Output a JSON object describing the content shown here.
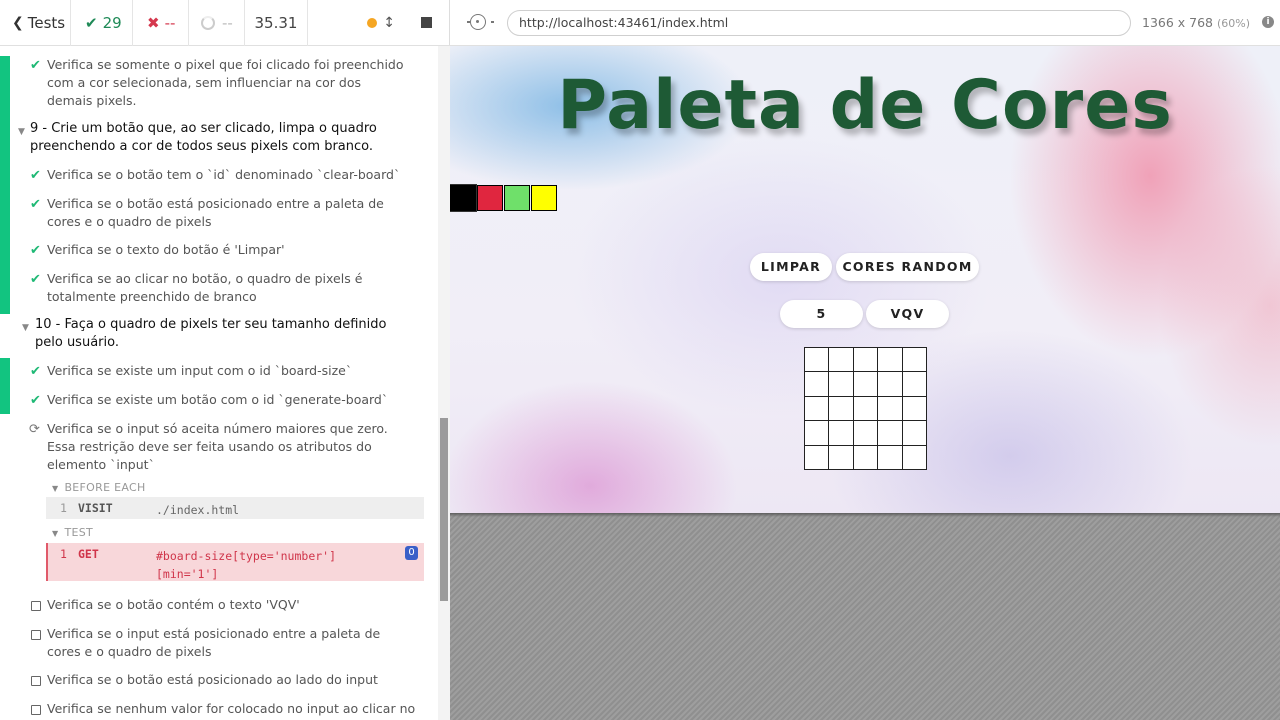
{
  "topbar": {
    "tests_label": "Tests",
    "passed": "29",
    "failed": "--",
    "pending": "--",
    "duration": "35.31"
  },
  "tests": {
    "t_pixel_fill": "Verifica se somente o pixel que foi clicado foi preenchido com a cor selecionada, sem influenciar na cor dos demais pixels.",
    "req9": "9 - Crie um botão que, ao ser clicado, limpa o quadro preenchendo a cor de todos seus pixels com branco.",
    "t9_1": "Verifica se o botão tem o `id` denominado `clear-board`",
    "t9_2": "Verifica se o botão está posicionado entre a paleta de cores e o quadro de pixels",
    "t9_3": "Verifica se o texto do botão é 'Limpar'",
    "t9_4": "Verifica se ao clicar no botão, o quadro de pixels é totalmente preenchido de branco",
    "req10": "10 - Faça o quadro de pixels ter seu tamanho definido pelo usuário.",
    "t10_1": "Verifica se existe um input com o id `board-size`",
    "t10_2": "Verifica se existe um botão com o id `generate-board`",
    "t10_3": "Verifica se o input só aceita número maiores que zero. Essa restrição deve ser feita usando os atributos do elemento `input`",
    "before_each": "BEFORE EACH",
    "visit_num": "1",
    "visit_cmd": "VISIT",
    "visit_arg": "./index.html",
    "test_label": "TEST",
    "get_num": "1",
    "get_cmd": "GET",
    "get_arg": "#board-size[type='number'] [min='1']",
    "get_badge": "0",
    "t10_4": "Verifica se o botão contém o texto 'VQV'",
    "t10_5": "Verifica se o input está posicionado entre a paleta de cores e o quadro de pixels",
    "t10_6": "Verifica se o botão está posicionado ao lado do input",
    "t10_7": "Verifica se nenhum valor for colocado no input ao clicar no"
  },
  "urlbar": {
    "url": "http://localhost:43461/index.html",
    "viewport": "1366 x 768",
    "zoom": "(60%)"
  },
  "app": {
    "title": "Paleta de Cores",
    "palette_colors": [
      "#000000",
      "#e0263f",
      "#6fe06a",
      "#ffff00"
    ],
    "clear_label": "LIMPAR",
    "random_label": "CORES RANDOM",
    "board_size_value": "5",
    "vqv_label": "VQV",
    "board_size": 5
  },
  "colors": {
    "pass": "#1fb975",
    "fail": "#d5384e",
    "title": "#1e5a35"
  }
}
